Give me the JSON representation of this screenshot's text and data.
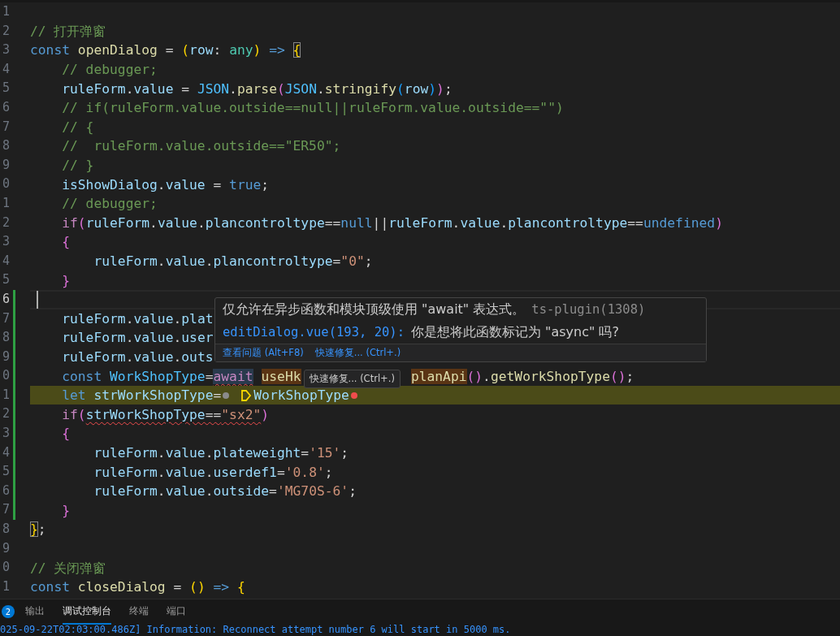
{
  "editor": {
    "lines": [
      {
        "num": "1",
        "current": false,
        "modified": false,
        "highlighted": false
      },
      {
        "num": "2",
        "current": false,
        "modified": false,
        "highlighted": false,
        "parts": [
          {
            "kind": "code",
            "tokens": [
              {
                "kind": "c",
                "t": "// 打开弹窗"
              }
            ]
          }
        ]
      },
      {
        "num": "3",
        "current": false,
        "modified": false,
        "highlighted": false,
        "parts": [
          {
            "kind": "code",
            "tokens": [
              {
                "kind": "kw",
                "t": "const "
              },
              {
                "kind": "f",
                "t": "openDialog"
              },
              {
                "kind": "p",
                "t": " = "
              },
              {
                "kind": "b1",
                "t": "("
              },
              {
                "kind": "v",
                "t": "row"
              },
              {
                "kind": "p",
                "t": ": "
              },
              {
                "kind": "t",
                "t": "any"
              },
              {
                "kind": "b1",
                "t": ")"
              },
              {
                "kind": "kw",
                "t": " => "
              },
              {
                "kind": "b1",
                "t": "{",
                "boxed": true
              }
            ]
          }
        ]
      },
      {
        "num": "4",
        "current": false,
        "modified": false,
        "highlighted": false,
        "parts": [
          {
            "kind": "code",
            "tokens": [
              {
                "kind": "c",
                "t": "    // debugger;"
              }
            ]
          }
        ]
      },
      {
        "num": "5",
        "current": false,
        "modified": false,
        "highlighted": false,
        "parts": [
          {
            "kind": "code",
            "tokens": [
              {
                "kind": "v",
                "t": "    ruleForm"
              },
              {
                "kind": "p",
                "t": "."
              },
              {
                "kind": "v",
                "t": "value"
              },
              {
                "kind": "p",
                "t": " = "
              },
              {
                "kind": "cv",
                "t": "JSON"
              },
              {
                "kind": "p",
                "t": "."
              },
              {
                "kind": "f",
                "t": "parse"
              },
              {
                "kind": "b2",
                "t": "("
              },
              {
                "kind": "cv",
                "t": "JSON"
              },
              {
                "kind": "p",
                "t": "."
              },
              {
                "kind": "f",
                "t": "stringify"
              },
              {
                "kind": "b3",
                "t": "("
              },
              {
                "kind": "v",
                "t": "row"
              },
              {
                "kind": "b3",
                "t": ")"
              },
              {
                "kind": "b2",
                "t": ")"
              },
              {
                "kind": "p",
                "t": ";"
              }
            ]
          }
        ]
      },
      {
        "num": "6",
        "current": false,
        "modified": false,
        "highlighted": false,
        "parts": [
          {
            "kind": "code",
            "tokens": [
              {
                "kind": "c",
                "t": "    // if(ruleForm.value.outside==null||ruleForm.value.outside==\"\")"
              }
            ]
          }
        ]
      },
      {
        "num": "7",
        "current": false,
        "modified": false,
        "highlighted": false,
        "parts": [
          {
            "kind": "code",
            "tokens": [
              {
                "kind": "c",
                "t": "    // {"
              }
            ]
          }
        ]
      },
      {
        "num": "8",
        "current": false,
        "modified": false,
        "highlighted": false,
        "parts": [
          {
            "kind": "code",
            "tokens": [
              {
                "kind": "c",
                "t": "    //  ruleForm.value.outside==\"ER50\";"
              }
            ]
          }
        ]
      },
      {
        "num": "9",
        "current": false,
        "modified": false,
        "highlighted": false,
        "parts": [
          {
            "kind": "code",
            "tokens": [
              {
                "kind": "c",
                "t": "    // }"
              }
            ]
          }
        ]
      },
      {
        "num": "0",
        "current": false,
        "modified": false,
        "highlighted": false,
        "parts": [
          {
            "kind": "code",
            "tokens": [
              {
                "kind": "v",
                "t": "    isShowDialog"
              },
              {
                "kind": "p",
                "t": "."
              },
              {
                "kind": "v",
                "t": "value"
              },
              {
                "kind": "p",
                "t": " = "
              },
              {
                "kind": "kw",
                "t": "true"
              },
              {
                "kind": "p",
                "t": ";"
              }
            ]
          }
        ]
      },
      {
        "num": "1",
        "current": false,
        "modified": false,
        "highlighted": false,
        "parts": [
          {
            "kind": "code",
            "tokens": [
              {
                "kind": "c",
                "t": "    // debugger;"
              }
            ]
          }
        ]
      },
      {
        "num": "2",
        "current": false,
        "modified": false,
        "highlighted": false,
        "parts": [
          {
            "kind": "code",
            "tokens": [
              {
                "kind": "ctl",
                "t": "    if"
              },
              {
                "kind": "b2",
                "t": "("
              },
              {
                "kind": "v",
                "t": "ruleForm"
              },
              {
                "kind": "p",
                "t": "."
              },
              {
                "kind": "v",
                "t": "value"
              },
              {
                "kind": "p",
                "t": "."
              },
              {
                "kind": "v",
                "t": "plancontroltype"
              },
              {
                "kind": "p",
                "t": "=="
              },
              {
                "kind": "kw",
                "t": "null"
              },
              {
                "kind": "p",
                "t": "||"
              },
              {
                "kind": "v",
                "t": "ruleForm"
              },
              {
                "kind": "p",
                "t": "."
              },
              {
                "kind": "v",
                "t": "value"
              },
              {
                "kind": "p",
                "t": "."
              },
              {
                "kind": "v",
                "t": "plancontroltype"
              },
              {
                "kind": "p",
                "t": "=="
              },
              {
                "kind": "kw",
                "t": "undefined"
              },
              {
                "kind": "b2",
                "t": ")"
              }
            ]
          }
        ]
      },
      {
        "num": "3",
        "current": false,
        "modified": false,
        "highlighted": false,
        "parts": [
          {
            "kind": "code",
            "tokens": [
              {
                "kind": "b2",
                "t": "    {"
              }
            ]
          }
        ]
      },
      {
        "num": "4",
        "current": false,
        "modified": false,
        "highlighted": false,
        "parts": [
          {
            "kind": "code",
            "tokens": [
              {
                "kind": "v",
                "t": "        ruleForm"
              },
              {
                "kind": "p",
                "t": "."
              },
              {
                "kind": "v",
                "t": "value"
              },
              {
                "kind": "p",
                "t": "."
              },
              {
                "kind": "v",
                "t": "plancontroltype"
              },
              {
                "kind": "p",
                "t": "="
              },
              {
                "kind": "s",
                "t": "\"0\""
              },
              {
                "kind": "p",
                "t": ";"
              }
            ]
          }
        ]
      },
      {
        "num": "5",
        "current": false,
        "modified": false,
        "highlighted": false,
        "parts": [
          {
            "kind": "code",
            "tokens": [
              {
                "kind": "b2",
                "t": "    }"
              }
            ]
          }
        ]
      },
      {
        "num": "6",
        "current": true,
        "modified": true,
        "highlighted": false,
        "parts": [
          {
            "kind": "cursor"
          }
        ]
      },
      {
        "num": "7",
        "current": false,
        "modified": true,
        "highlighted": false,
        "parts": [
          {
            "kind": "code",
            "tokens": [
              {
                "kind": "v",
                "t": "    ruleForm"
              },
              {
                "kind": "p",
                "t": "."
              },
              {
                "kind": "v",
                "t": "value"
              },
              {
                "kind": "p",
                "t": "."
              },
              {
                "kind": "v",
                "t": "plat"
              }
            ]
          }
        ]
      },
      {
        "num": "8",
        "current": false,
        "modified": true,
        "highlighted": false,
        "parts": [
          {
            "kind": "code",
            "tokens": [
              {
                "kind": "v",
                "t": "    ruleForm"
              },
              {
                "kind": "p",
                "t": "."
              },
              {
                "kind": "v",
                "t": "value"
              },
              {
                "kind": "p",
                "t": "."
              },
              {
                "kind": "v",
                "t": "user"
              }
            ]
          }
        ]
      },
      {
        "num": "9",
        "current": false,
        "modified": true,
        "highlighted": false,
        "parts": [
          {
            "kind": "code",
            "tokens": [
              {
                "kind": "v",
                "t": "    ruleForm"
              },
              {
                "kind": "p",
                "t": "."
              },
              {
                "kind": "v",
                "t": "value"
              },
              {
                "kind": "p",
                "t": "."
              },
              {
                "kind": "v",
                "t": "outs"
              }
            ]
          }
        ]
      },
      {
        "num": "0",
        "current": false,
        "modified": true,
        "highlighted": false,
        "parts": [
          {
            "kind": "code",
            "tokens": [
              {
                "kind": "kw",
                "t": "    const "
              },
              {
                "kind": "cv",
                "t": "WorkShopType"
              },
              {
                "kind": "p",
                "t": "="
              },
              {
                "kind": "ctl",
                "t": "await",
                "squiggle": true,
                "symbol_highlight": true
              },
              {
                "kind": "f",
                "t": "useHk",
                "range_highlight": true
              }
            ]
          },
          {
            "kind": "tooltip",
            "text": "快速修复... (Ctrl+.)"
          },
          {
            "kind": "code",
            "tokens": [
              {
                "kind": "f",
                "t": "planApi",
                "range_highlight": true
              },
              {
                "kind": "b2",
                "t": "()"
              },
              {
                "kind": "p",
                "t": "."
              },
              {
                "kind": "f",
                "t": "getWorkShopType"
              },
              {
                "kind": "b2",
                "t": "()"
              },
              {
                "kind": "p",
                "t": ";"
              }
            ]
          }
        ]
      },
      {
        "num": "1",
        "current": false,
        "modified": true,
        "highlighted": true,
        "parts": [
          {
            "kind": "code",
            "tokens": [
              {
                "kind": "kw",
                "t": "    let "
              },
              {
                "kind": "v",
                "t": "strWorkShopType"
              },
              {
                "kind": "p",
                "t": "="
              }
            ]
          },
          {
            "kind": "dot",
            "color": "#8a8a8a"
          },
          {
            "kind": "symbol-icon"
          },
          {
            "kind": "code",
            "tokens": [
              {
                "kind": "v",
                "t": "WorkShopType"
              }
            ]
          },
          {
            "kind": "dot",
            "color": "#f14c4c"
          }
        ]
      },
      {
        "num": "2",
        "current": false,
        "modified": true,
        "highlighted": false,
        "parts": [
          {
            "kind": "code",
            "tokens": [
              {
                "kind": "ctl",
                "t": "    if"
              },
              {
                "kind": "b2",
                "t": "("
              },
              {
                "kind": "v",
                "t": "strWorkShopType",
                "squiggle": true
              },
              {
                "kind": "p",
                "t": "==",
                "squiggle": true
              },
              {
                "kind": "s",
                "t": "\"sx2\"",
                "squiggle": true
              },
              {
                "kind": "b2",
                "t": ")"
              }
            ]
          }
        ]
      },
      {
        "num": "3",
        "current": false,
        "modified": true,
        "highlighted": false,
        "parts": [
          {
            "kind": "code",
            "tokens": [
              {
                "kind": "b2",
                "t": "    {"
              }
            ]
          }
        ]
      },
      {
        "num": "4",
        "current": false,
        "modified": true,
        "highlighted": false,
        "parts": [
          {
            "kind": "code",
            "tokens": [
              {
                "kind": "v",
                "t": "        ruleForm"
              },
              {
                "kind": "p",
                "t": "."
              },
              {
                "kind": "v",
                "t": "value"
              },
              {
                "kind": "p",
                "t": "."
              },
              {
                "kind": "v",
                "t": "plateweight"
              },
              {
                "kind": "p",
                "t": "="
              },
              {
                "kind": "s",
                "t": "'15'"
              },
              {
                "kind": "p",
                "t": ";"
              }
            ]
          }
        ]
      },
      {
        "num": "5",
        "current": false,
        "modified": true,
        "highlighted": false,
        "parts": [
          {
            "kind": "code",
            "tokens": [
              {
                "kind": "v",
                "t": "        ruleForm"
              },
              {
                "kind": "p",
                "t": "."
              },
              {
                "kind": "v",
                "t": "value"
              },
              {
                "kind": "p",
                "t": "."
              },
              {
                "kind": "v",
                "t": "userdef1"
              },
              {
                "kind": "p",
                "t": "="
              },
              {
                "kind": "s",
                "t": "'0.8'"
              },
              {
                "kind": "p",
                "t": ";"
              }
            ]
          }
        ]
      },
      {
        "num": "6",
        "current": false,
        "modified": true,
        "highlighted": false,
        "parts": [
          {
            "kind": "code",
            "tokens": [
              {
                "kind": "v",
                "t": "        ruleForm"
              },
              {
                "kind": "p",
                "t": "."
              },
              {
                "kind": "v",
                "t": "value"
              },
              {
                "kind": "p",
                "t": "."
              },
              {
                "kind": "v",
                "t": "outside"
              },
              {
                "kind": "p",
                "t": "="
              },
              {
                "kind": "s",
                "t": "'MG70S-6'"
              },
              {
                "kind": "p",
                "t": ";"
              }
            ]
          }
        ]
      },
      {
        "num": "7",
        "current": false,
        "modified": true,
        "highlighted": false,
        "parts": [
          {
            "kind": "code",
            "tokens": [
              {
                "kind": "b2",
                "t": "    }"
              }
            ]
          }
        ]
      },
      {
        "num": "8",
        "current": false,
        "modified": false,
        "highlighted": false,
        "parts": [
          {
            "kind": "code",
            "tokens": [
              {
                "kind": "b1",
                "t": "}",
                "boxed": true
              },
              {
                "kind": "p",
                "t": ";"
              }
            ]
          }
        ]
      },
      {
        "num": "9",
        "current": false,
        "modified": false,
        "highlighted": false
      },
      {
        "num": "0",
        "current": false,
        "modified": false,
        "highlighted": false,
        "parts": [
          {
            "kind": "code",
            "tokens": [
              {
                "kind": "c",
                "t": "// 关闭弹窗"
              }
            ]
          }
        ]
      },
      {
        "num": "1",
        "current": false,
        "modified": false,
        "highlighted": false,
        "parts": [
          {
            "kind": "code",
            "tokens": [
              {
                "kind": "kw",
                "t": "const "
              },
              {
                "kind": "f",
                "t": "closeDialog"
              },
              {
                "kind": "p",
                "t": " = "
              },
              {
                "kind": "b1",
                "t": "()"
              },
              {
                "kind": "kw",
                "t": " => "
              },
              {
                "kind": "b1",
                "t": "{"
              }
            ]
          }
        ]
      }
    ],
    "hover": {
      "message": "仅允许在异步函数和模块顶级使用 \"await\" 表达式。",
      "source": "ts-plugin(1308)",
      "location": "editDialog.vue(193, 20):",
      "hint": "你是想将此函数标记为 \"async\" 吗?",
      "actions": [
        "查看问题 (Alt+F8)",
        "快速修复... (Ctrl+.)"
      ]
    }
  },
  "panel": {
    "badge": "2",
    "tabs": [
      {
        "label": "输出",
        "selected": false
      },
      {
        "label": "调试控制台",
        "selected": true
      },
      {
        "label": "终端",
        "selected": false
      },
      {
        "label": "端口",
        "selected": false
      }
    ],
    "output": "025-09-22T02:03:00.486Z] Information: Reconnect attempt number 6 will start in 5000 ms."
  }
}
